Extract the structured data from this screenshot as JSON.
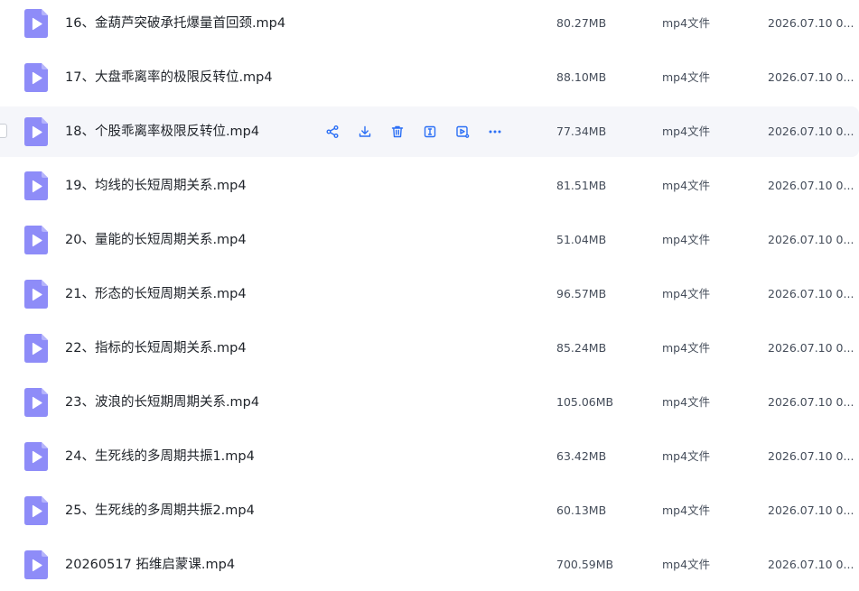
{
  "colors": {
    "icon_purple": "#8e8cf8",
    "icon_purple_fold": "#b5b4fb",
    "action_blue": "#2b6ff5",
    "hover_bg": "#f5f6fa"
  },
  "actions": [
    {
      "name": "share-icon",
      "label": "share"
    },
    {
      "name": "download-icon",
      "label": "download"
    },
    {
      "name": "trash-icon",
      "label": "delete"
    },
    {
      "name": "rename-icon",
      "label": "rename"
    },
    {
      "name": "play-icon",
      "label": "play"
    },
    {
      "name": "more-icon",
      "label": "more"
    }
  ],
  "files": [
    {
      "name": "16、金葫芦突破承托爆量首回颈.mp4",
      "size": "80.27MB",
      "type": "mp4文件",
      "date": "2026.07.10 0..."
    },
    {
      "name": "17、大盘乖离率的极限反转位.mp4",
      "size": "88.10MB",
      "type": "mp4文件",
      "date": "2026.07.10 0..."
    },
    {
      "name": "18、个股乖离率极限反转位.mp4",
      "size": "77.34MB",
      "type": "mp4文件",
      "date": "2026.07.10 0..."
    },
    {
      "name": "19、均线的长短周期关系.mp4",
      "size": "81.51MB",
      "type": "mp4文件",
      "date": "2026.07.10 0..."
    },
    {
      "name": "20、量能的长短周期关系.mp4",
      "size": "51.04MB",
      "type": "mp4文件",
      "date": "2026.07.10 0..."
    },
    {
      "name": "21、形态的长短周期关系.mp4",
      "size": "96.57MB",
      "type": "mp4文件",
      "date": "2026.07.10 0..."
    },
    {
      "name": "22、指标的长短周期关系.mp4",
      "size": "85.24MB",
      "type": "mp4文件",
      "date": "2026.07.10 0..."
    },
    {
      "name": "23、波浪的长短期周期关系.mp4",
      "size": "105.06MB",
      "type": "mp4文件",
      "date": "2026.07.10 0..."
    },
    {
      "name": "24、生死线的多周期共振1.mp4",
      "size": "63.42MB",
      "type": "mp4文件",
      "date": "2026.07.10 0..."
    },
    {
      "name": "25、生死线的多周期共振2.mp4",
      "size": "60.13MB",
      "type": "mp4文件",
      "date": "2026.07.10 0..."
    },
    {
      "name": "20260517 拓维启蒙课.mp4",
      "size": "700.59MB",
      "type": "mp4文件",
      "date": "2026.07.10 0..."
    }
  ]
}
